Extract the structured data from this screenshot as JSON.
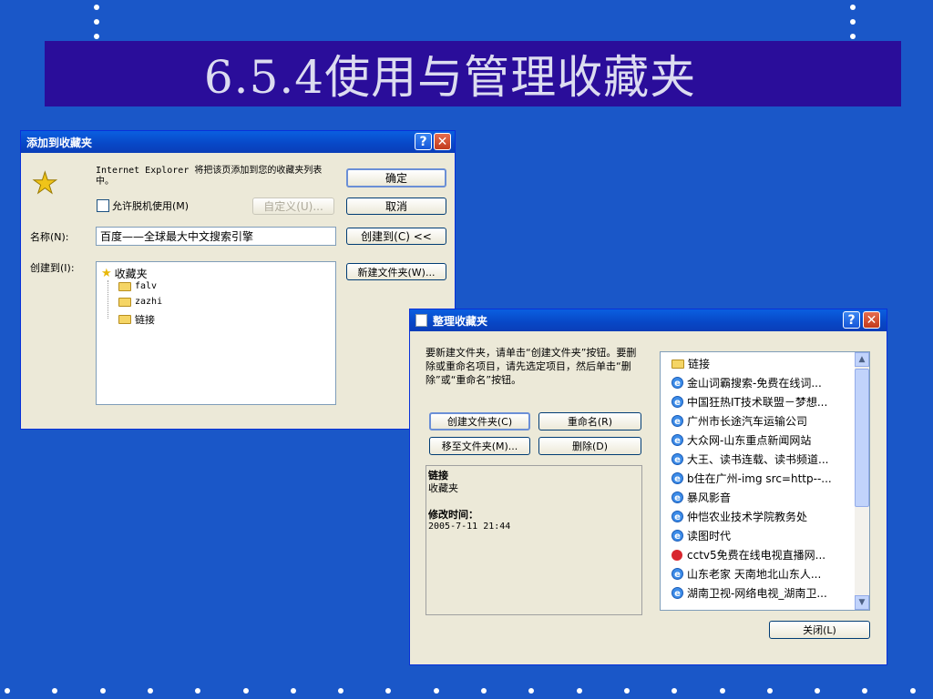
{
  "slide": {
    "title": "6.5.4使用与管理收藏夹"
  },
  "colors": {
    "background": "#1a57c8",
    "title_band": "#2a0d9a",
    "xp_titlebar": "#0847c6",
    "dialog_face": "#ece9d8"
  },
  "add_dialog": {
    "title": "添加到收藏夹",
    "help_glyph": "?",
    "close_glyph": "✕",
    "star_icon": "★",
    "message": "Internet Explorer 将把该页添加到您的收藏夹列表中。",
    "offline_checkbox": "允许脱机使用(M)",
    "customize_button": "自定义(U)...",
    "ok_button": "确定",
    "cancel_button": "取消",
    "name_label": "名称(N):",
    "name_value": "百度——全球最大中文搜索引擎",
    "create_in_button": "创建到(C) <<",
    "create_in_label": "创建到(I):",
    "new_folder_button": "新建文件夹(W)...",
    "tree": {
      "root": "收藏夹",
      "children": [
        "falv",
        "zazhi",
        "链接"
      ]
    }
  },
  "organize_dialog": {
    "title": "整理收藏夹",
    "help_glyph": "?",
    "close_glyph": "✕",
    "instructions": "要新建文件夹，请单击“创建文件夹”按钮。要删除或重命名项目，请先选定项目，然后单击“删除”或“重命名”按钮。",
    "create_folder_button": "创建文件夹(C)",
    "rename_button": "重命名(R)",
    "move_button": "移至文件夹(M)...",
    "delete_button": "删除(D)",
    "info": {
      "name": "链接",
      "type": "收藏夹",
      "modified_label": "修改时间：",
      "modified_value": "2005-7-11 21:44"
    },
    "list": [
      {
        "icon": "folder-icon",
        "label": "链接"
      },
      {
        "icon": "ie-page-icon",
        "label": "金山词霸搜索-免费在线词..."
      },
      {
        "icon": "ie-page-icon",
        "label": "中国狂热IT技术联盟－梦想..."
      },
      {
        "icon": "ie-page-icon",
        "label": "广州市长途汽车运输公司"
      },
      {
        "icon": "ie-page-icon",
        "label": "大众网-山东重点新闻网站"
      },
      {
        "icon": "ie-page-icon",
        "label": "大王、读书连载、读书频道..."
      },
      {
        "icon": "ie-page-icon",
        "label": "b住在广州-img src=http--..."
      },
      {
        "icon": "ie-page-icon",
        "label": "暴风影音"
      },
      {
        "icon": "ie-page-icon",
        "label": "仲恺农业技术学院教务处"
      },
      {
        "icon": "ie-page-icon",
        "label": "读图时代"
      },
      {
        "icon": "tv-icon",
        "label": "cctv5免费在线电视直播网..."
      },
      {
        "icon": "ie-page-icon",
        "label": "山东老家 天南地北山东人..."
      },
      {
        "icon": "ie-page-icon",
        "label": "湖南卫视-网络电视_湖南卫..."
      }
    ],
    "scroll_up": "▲",
    "scroll_down": "▼",
    "close_button": "关闭(L)"
  }
}
